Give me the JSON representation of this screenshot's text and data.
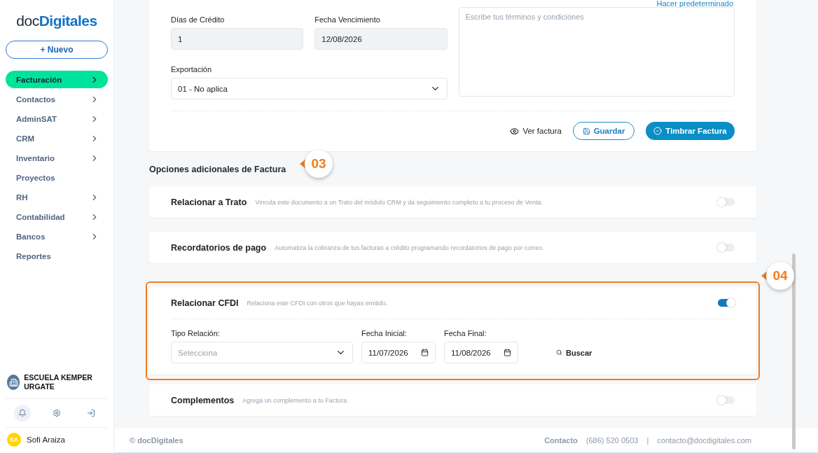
{
  "sidebar": {
    "logo": {
      "part_1": "doc",
      "part_2": "Digitales"
    },
    "new_button": {
      "icon": "+",
      "label": "Nuevo"
    },
    "items": [
      {
        "label": "Facturación",
        "selected": true,
        "has_submenu": true
      },
      {
        "label": "Contactos",
        "selected": false,
        "has_submenu": true
      },
      {
        "label": "AdminSAT",
        "selected": false,
        "has_submenu": true
      },
      {
        "label": "CRM",
        "selected": false,
        "has_submenu": true
      },
      {
        "label": "Inventario",
        "selected": false,
        "has_submenu": true
      },
      {
        "label": "Proyectos",
        "selected": false,
        "has_submenu": false
      },
      {
        "label": "RH",
        "selected": false,
        "has_submenu": true
      },
      {
        "label": "Contabilidad",
        "selected": false,
        "has_submenu": true
      },
      {
        "label": "Bancos",
        "selected": false,
        "has_submenu": true
      },
      {
        "label": "Reportes",
        "selected": false,
        "has_submenu": false
      }
    ],
    "company": "ESCUELA KEMPER URGATE",
    "user": {
      "initials": "SA",
      "name": "Sofi Araiza"
    }
  },
  "invoice_form": {
    "default_link": "Hacer predeterminado",
    "fields": [
      {
        "label": "Días de Crédito",
        "value": "1"
      },
      {
        "label": "Fecha Vencimiento",
        "value": "12/08/2026"
      }
    ],
    "export": {
      "label": "Exportación",
      "value": "01 - No aplica"
    },
    "terms": {
      "placeholder": "Escribe tus términos y condiciones"
    },
    "actions": {
      "preview": "Ver factura",
      "save": "Guardar",
      "stamp": "Timbrar Factura"
    }
  },
  "options_title": "Opciones adicionales de Factura",
  "options": [
    {
      "title": "Relacionar a Trato",
      "description": "Vincula este documento a un Trato del módulo CRM y da seguimiento completo a tu proceso de Venta.",
      "on": false,
      "highlighted": false
    },
    {
      "title": "Recordatorios de pago",
      "description": "Automatiza la cobranza de tus facturas a crédito programando recordatorios de pago por correo.",
      "on": false,
      "highlighted": false
    },
    {
      "title": "Relacionar CFDI",
      "description": "Relaciona este CFDI con otros que hayas emitido.",
      "on": true,
      "highlighted": true,
      "filters": {
        "type": {
          "label": "Tipo Relación:",
          "placeholder": "Selecciona"
        },
        "start": {
          "label": "Fecha Inicial:",
          "value": "11/07/2026"
        },
        "end": {
          "label": "Fecha Final:",
          "value": "11/08/2026"
        },
        "search": "Buscar"
      }
    },
    {
      "title": "Complementos",
      "description": "Agrega un complemento a tu Factura.",
      "on": false,
      "highlighted": false
    }
  ],
  "callouts": [
    "03",
    "04"
  ],
  "footer": {
    "copyright": "© docDigitales",
    "contact_label": "Contacto",
    "phone": "(686) 520 0503",
    "separator": "|",
    "email": "contacto@docdigitales.com"
  }
}
